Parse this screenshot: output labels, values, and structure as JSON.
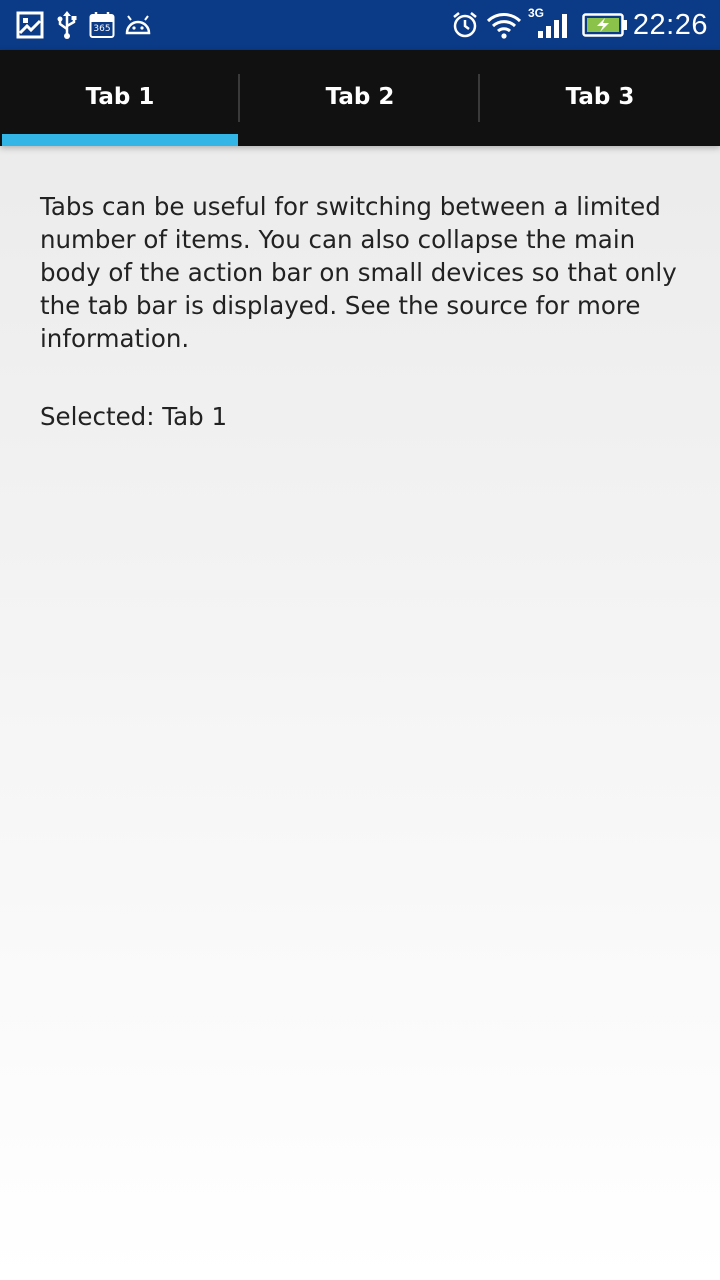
{
  "status_bar": {
    "time": "22:26",
    "network_type": "3G",
    "calendar_number": "365",
    "left_icons": [
      "gallery-icon",
      "usb-icon",
      "calendar-icon",
      "android-icon"
    ],
    "right_icons": [
      "alarm-icon",
      "wifi-icon",
      "cellular-signal-icon",
      "battery-charging-icon"
    ],
    "color": "#0b3a87"
  },
  "tabs": [
    {
      "label": "Tab 1",
      "selected": true
    },
    {
      "label": "Tab 2",
      "selected": false
    },
    {
      "label": "Tab 3",
      "selected": false
    }
  ],
  "tab_bar_color": "#111111",
  "indicator_color": "#33b5e5",
  "content": {
    "description": "Tabs can be useful for switching between a limited number of items. You can also collapse the main body of the action bar on small devices so that only the tab bar is displayed. See the source for more information.",
    "selected_text": "Selected: Tab 1"
  }
}
